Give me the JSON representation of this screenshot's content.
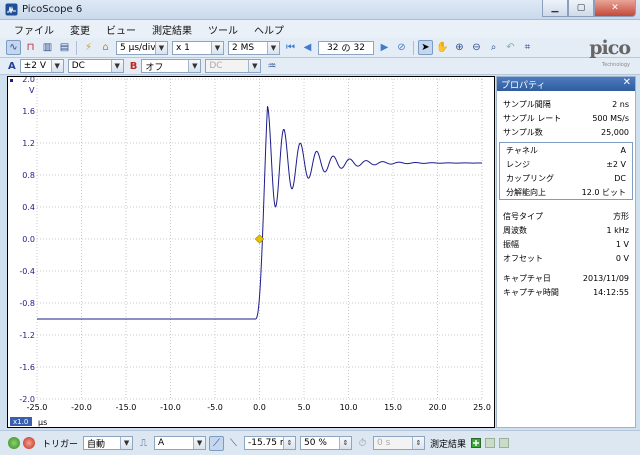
{
  "window": {
    "title": "PicoScope 6"
  },
  "menu": [
    "ファイル",
    "変更",
    "ビュー",
    "測定結果",
    "ツール",
    "ヘルプ"
  ],
  "toolbar": {
    "timebase": "5 µs/div",
    "zoom": "x 1",
    "samples": "2 MS",
    "buffer_current": "32",
    "buffer_of": "の",
    "buffer_total": "32"
  },
  "channels": {
    "a": {
      "label": "A",
      "range": "±2 V",
      "coupling": "DC"
    },
    "b": {
      "label": "B",
      "range": "オフ",
      "coupling": "DC"
    }
  },
  "logo": {
    "name": "pico",
    "sub": "Technology"
  },
  "chart_data": {
    "type": "line",
    "y_unit_label": "V",
    "x_unit_label": "µs",
    "xlim": [
      -25.0,
      25.0
    ],
    "ylim": [
      -2.0,
      2.0
    ],
    "x_ticks": [
      "-25.0",
      "-20.0",
      "-15.0",
      "-10.0",
      "-5.0",
      "0.0",
      "5.0",
      "10.0",
      "15.0",
      "20.0",
      "25.0"
    ],
    "y_ticks": [
      "2.0",
      "1.6",
      "1.2",
      "0.8",
      "0.4",
      "0.0",
      "-0.4",
      "-0.8",
      "-1.2",
      "-1.6",
      "-2.0"
    ],
    "grid": true,
    "series_color": "#1c1c8c",
    "trigger_marker_color": "#e6c200",
    "trigger_point": {
      "x": 0.0,
      "y": 0.0
    },
    "zoom_badge": "x1.0",
    "waveform": {
      "low_level": -1.0,
      "step_start": -0.5,
      "rise_end": 0.9,
      "settle_level": 0.95,
      "first_peak": 1.66,
      "ring_period": 1.85,
      "ring_decay": 3.5
    }
  },
  "properties": {
    "title": "プロパティ",
    "sampling": [
      {
        "label": "サンプル間隔",
        "value": "2 ns"
      },
      {
        "label": "サンプル レート",
        "value": "500 MS/s"
      },
      {
        "label": "サンプル数",
        "value": "25,000"
      }
    ],
    "channel": [
      {
        "label": "チャネル",
        "value": "A"
      },
      {
        "label": "レンジ",
        "value": "±2 V"
      },
      {
        "label": "カップリング",
        "value": "DC"
      },
      {
        "label": "分解能向上",
        "value": "12.0 ビット"
      }
    ],
    "signal": [
      {
        "label": "信号タイプ",
        "value": "方形"
      },
      {
        "label": "周波数",
        "value": "1 kHz"
      },
      {
        "label": "振幅",
        "value": "1 V"
      },
      {
        "label": "オフセット",
        "value": "0 V"
      }
    ],
    "capture": [
      {
        "label": "キャプチャ日",
        "value": "2013/11/09"
      },
      {
        "label": "キャプチャ時間",
        "value": "14:12:55"
      }
    ]
  },
  "status": {
    "trigger_label": "トリガー",
    "trigger_mode": "自動",
    "trigger_channel": "A",
    "trigger_level": "-15.75 m",
    "pretrigger": "50 %",
    "delay": "0 s",
    "measurements_label": "測定結果"
  }
}
